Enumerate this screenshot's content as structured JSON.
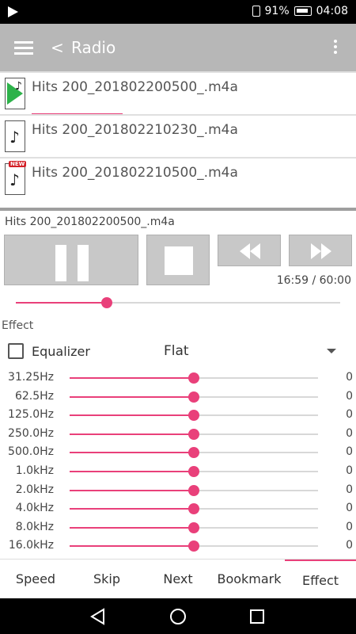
{
  "status_bar": {
    "battery": "91%",
    "time": "04:08"
  },
  "app_bar": {
    "back_label": "<",
    "title": "Radio"
  },
  "files": [
    {
      "name": "Hits 200_201802200500_.m4a",
      "icon": "playing-file-icon",
      "new": false
    },
    {
      "name": "Hits 200_201802210230_.m4a",
      "icon": "music-file-icon",
      "new": false
    },
    {
      "name": "Hits 200_201802210500_.m4a",
      "icon": "music-file-icon",
      "new": true,
      "new_label": "NEW"
    }
  ],
  "player": {
    "now_playing": "Hits 200_201802200500_.m4a",
    "time": "16:59 / 60:00",
    "position_fraction": 0.28
  },
  "effect": {
    "section_label": "Effect",
    "equalizer_label": "Equalizer",
    "equalizer_checked": false,
    "preset": "Flat",
    "bands": [
      {
        "freq": "31.25Hz",
        "value": "0",
        "level": 0.5
      },
      {
        "freq": "62.5Hz",
        "value": "0",
        "level": 0.5
      },
      {
        "freq": "125.0Hz",
        "value": "0",
        "level": 0.5
      },
      {
        "freq": "250.0Hz",
        "value": "0",
        "level": 0.5
      },
      {
        "freq": "500.0Hz",
        "value": "0",
        "level": 0.5
      },
      {
        "freq": "1.0kHz",
        "value": "0",
        "level": 0.5
      },
      {
        "freq": "2.0kHz",
        "value": "0",
        "level": 0.5
      },
      {
        "freq": "4.0kHz",
        "value": "0",
        "level": 0.5
      },
      {
        "freq": "8.0kHz",
        "value": "0",
        "level": 0.5
      },
      {
        "freq": "16.0kHz",
        "value": "0",
        "level": 0.5
      }
    ]
  },
  "tabs": [
    {
      "label": "Speed",
      "active": false
    },
    {
      "label": "Skip",
      "active": false
    },
    {
      "label": "Next",
      "active": false
    },
    {
      "label": "Bookmark",
      "active": false
    },
    {
      "label": "Effect",
      "active": true
    }
  ],
  "colors": {
    "accent": "#e9407a",
    "app_bar": "#b7b7b7",
    "button": "#c8c8c8"
  }
}
